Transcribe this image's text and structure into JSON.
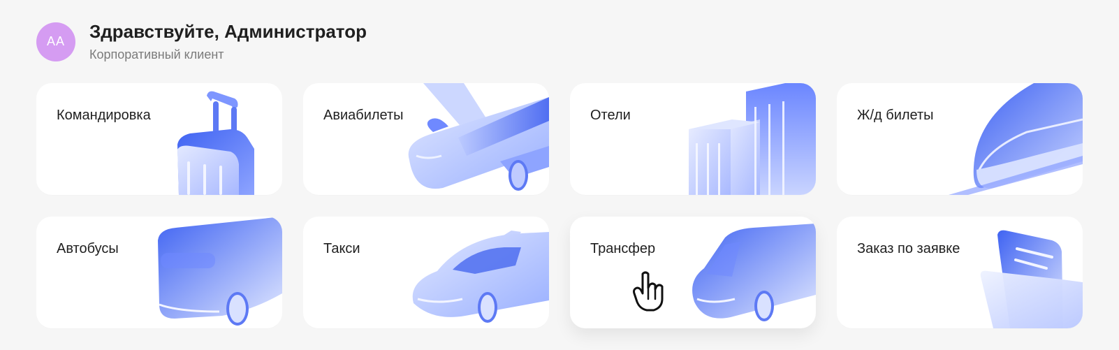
{
  "header": {
    "avatar_initials": "AA",
    "title": "Здравствуйте, Администратор",
    "subtitle": "Корпоративный клиент"
  },
  "services": [
    {
      "label": "Командировка",
      "icon": "suitcase-icon"
    },
    {
      "label": "Авиабилеты",
      "icon": "airplane-icon"
    },
    {
      "label": "Отели",
      "icon": "hotel-building-icon"
    },
    {
      "label": "Ж/д билеты",
      "icon": "train-icon"
    },
    {
      "label": "Автобусы",
      "icon": "bus-icon"
    },
    {
      "label": "Такси",
      "icon": "taxi-icon"
    },
    {
      "label": "Трансфер",
      "icon": "van-icon"
    },
    {
      "label": "Заказ по заявке",
      "icon": "request-document-icon"
    }
  ],
  "colors": {
    "background": "#f6f6f6",
    "card": "#ffffff",
    "text": "#1f1f1f",
    "muted": "#7b7b7b",
    "accent": "#4f6ef0",
    "avatar": "#d59cf2"
  },
  "hovered_service": "Трансфер",
  "cursor": "hand-pointer-icon"
}
